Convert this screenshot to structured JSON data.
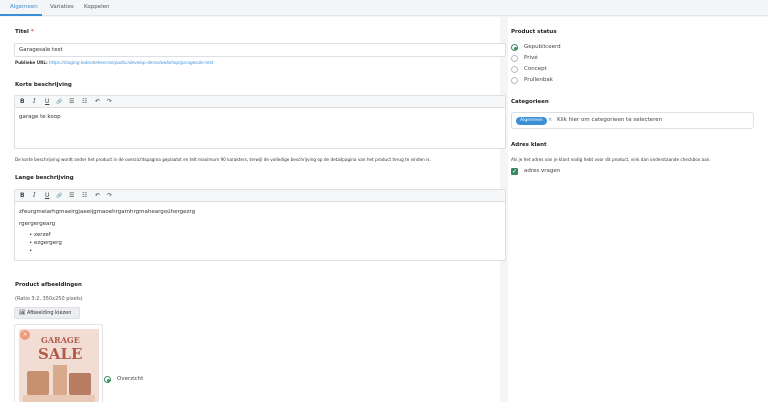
{
  "tabs": [
    "Algemeen",
    "Variaties",
    "Koppelen"
  ],
  "titel": {
    "label": "Titel",
    "required_mark": "*",
    "value": "Garagesale test",
    "url_prefix": "Publieke URL:",
    "url": "https://staging.ledenbeheer.be/public/develop-demo/webshop/garagesale-test"
  },
  "korte": {
    "label": "Korte beschrijving",
    "text": "garage te koop",
    "help": "De korte beschrijving wordt onder het product in de overzichtspagina geplaatst en telt maximum 90 karakters, terwijl de volledige beschrijving op de detailpagina van het product terug te vinden is."
  },
  "lange": {
    "label": "Lange beschrijving",
    "line1": "zfeurgmeiarhgmaeirgjaeeijgmaoehrgamhrgmaheargoühergezrg",
    "line2": "rgergergearg",
    "bullets": [
      "zerzef",
      "ezgergerg",
      ""
    ]
  },
  "toolbar": {
    "bold": "B",
    "italic": "I",
    "underline": "U",
    "link": "🔗",
    "ul": "☰",
    "ol": "☷",
    "undo": "↶",
    "redo": "↷"
  },
  "afbeeldingen": {
    "label": "Product afbeeldingen",
    "ratio": "(Ratio 3:2, 350x250 pixels)",
    "button": "Afbeelding kiezen",
    "poster_line1": "GARAGE",
    "poster_line2": "SALE",
    "overzicht": "Overzicht"
  },
  "status": {
    "label": "Product status",
    "options": [
      "Gepubliceerd",
      "Privé",
      "Concept",
      "Prullenbak"
    ],
    "selected": "Gepubliceerd"
  },
  "categorieen": {
    "label": "Categorieen",
    "tag": "Algemeen",
    "placeholder": "Klik hier om categorieen te selecteren"
  },
  "adres": {
    "label": "Adres klant",
    "help": "Als je het adres van je klant nodig hebt voor dit product, vink dan onderstaande checkbox aan.",
    "checkbox_label": "adres vragen",
    "checked": true
  },
  "icons": {
    "image_icon": "🖼",
    "close_icon": "×",
    "check_icon": "✓"
  },
  "colors": {
    "accent": "#3c8fd6",
    "success": "#3d8a60",
    "poster_badge": "#f09a7a"
  }
}
